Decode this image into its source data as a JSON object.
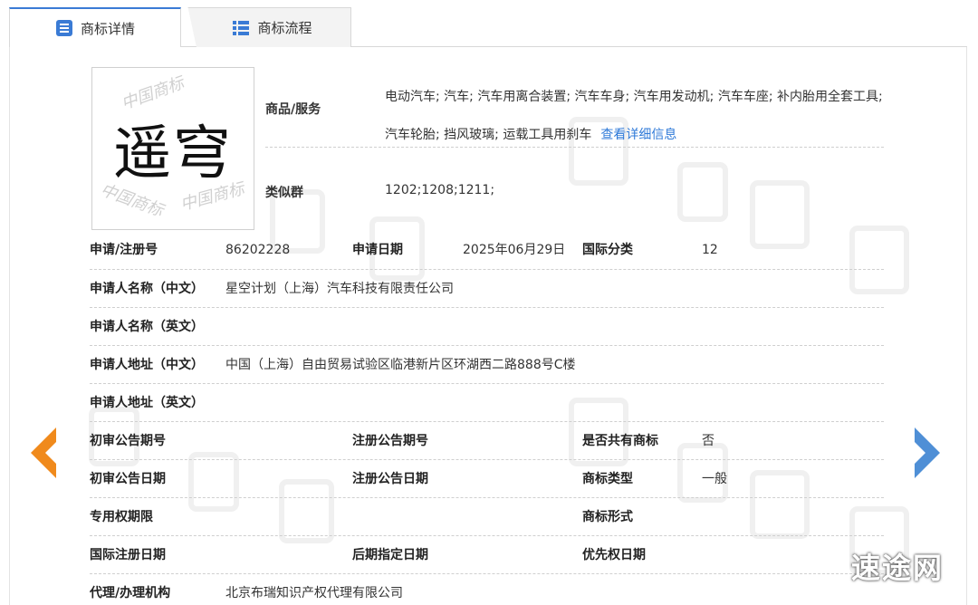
{
  "tabs": [
    {
      "label": "商标详情",
      "icon": "document-list-icon",
      "active": true
    },
    {
      "label": "商标流程",
      "icon": "grid-list-icon",
      "active": false
    }
  ],
  "trademark": {
    "mark_text": "遥穹",
    "goods_label": "商品/服务",
    "goods_value": "电动汽车; 汽车; 汽车用离合装置; 汽车车身; 汽车用发动机; 汽车车座; 补内胎用全套工具; 汽车轮胎; 挡风玻璃; 运载工具用刹车",
    "goods_more": "查看详细信息",
    "similar_label": "类似群",
    "similar_value": "1202;1208;1211;"
  },
  "rows": [
    {
      "cells": [
        {
          "label": "申请/注册号",
          "value": "86202228"
        },
        {
          "label": "申请日期",
          "value": "2025年06月29日"
        },
        {
          "label": "国际分类",
          "value": "12"
        }
      ]
    },
    {
      "cells": [
        {
          "label": "申请人名称（中文）",
          "value": "星空计划（上海）汽车科技有限责任公司"
        }
      ]
    },
    {
      "cells": [
        {
          "label": "申请人名称（英文）",
          "value": ""
        }
      ]
    },
    {
      "cells": [
        {
          "label": "申请人地址（中文）",
          "value": "中国（上海）自由贸易试验区临港新片区环湖西二路888号C楼"
        }
      ]
    },
    {
      "cells": [
        {
          "label": "申请人地址（英文）",
          "value": ""
        }
      ]
    },
    {
      "cells": [
        {
          "label": "初审公告期号",
          "value": ""
        },
        {
          "label": "注册公告期号",
          "value": ""
        },
        {
          "label": "是否共有商标",
          "value": "否"
        }
      ]
    },
    {
      "cells": [
        {
          "label": "初审公告日期",
          "value": ""
        },
        {
          "label": "注册公告日期",
          "value": ""
        },
        {
          "label": "商标类型",
          "value": "一般"
        }
      ]
    },
    {
      "cells": [
        {
          "label": "专用权期限",
          "value": ""
        },
        {
          "label": "",
          "value": ""
        },
        {
          "label": "商标形式",
          "value": ""
        }
      ]
    },
    {
      "cells": [
        {
          "label": "国际注册日期",
          "value": ""
        },
        {
          "label": "后期指定日期",
          "value": ""
        },
        {
          "label": "优先权日期",
          "value": ""
        }
      ]
    },
    {
      "cells": [
        {
          "label": "代理/办理机构",
          "value": "北京布瑞知识产权代理有限公司"
        }
      ]
    }
  ],
  "nav": {
    "prev": "chevron-left-icon",
    "next": "chevron-right-icon"
  },
  "site_mark": "速途网",
  "colors": {
    "accent": "#3a7bd5",
    "link": "#2f7ad8",
    "arrow_left": "#f08a1c",
    "arrow_right": "#4f8fd6"
  }
}
